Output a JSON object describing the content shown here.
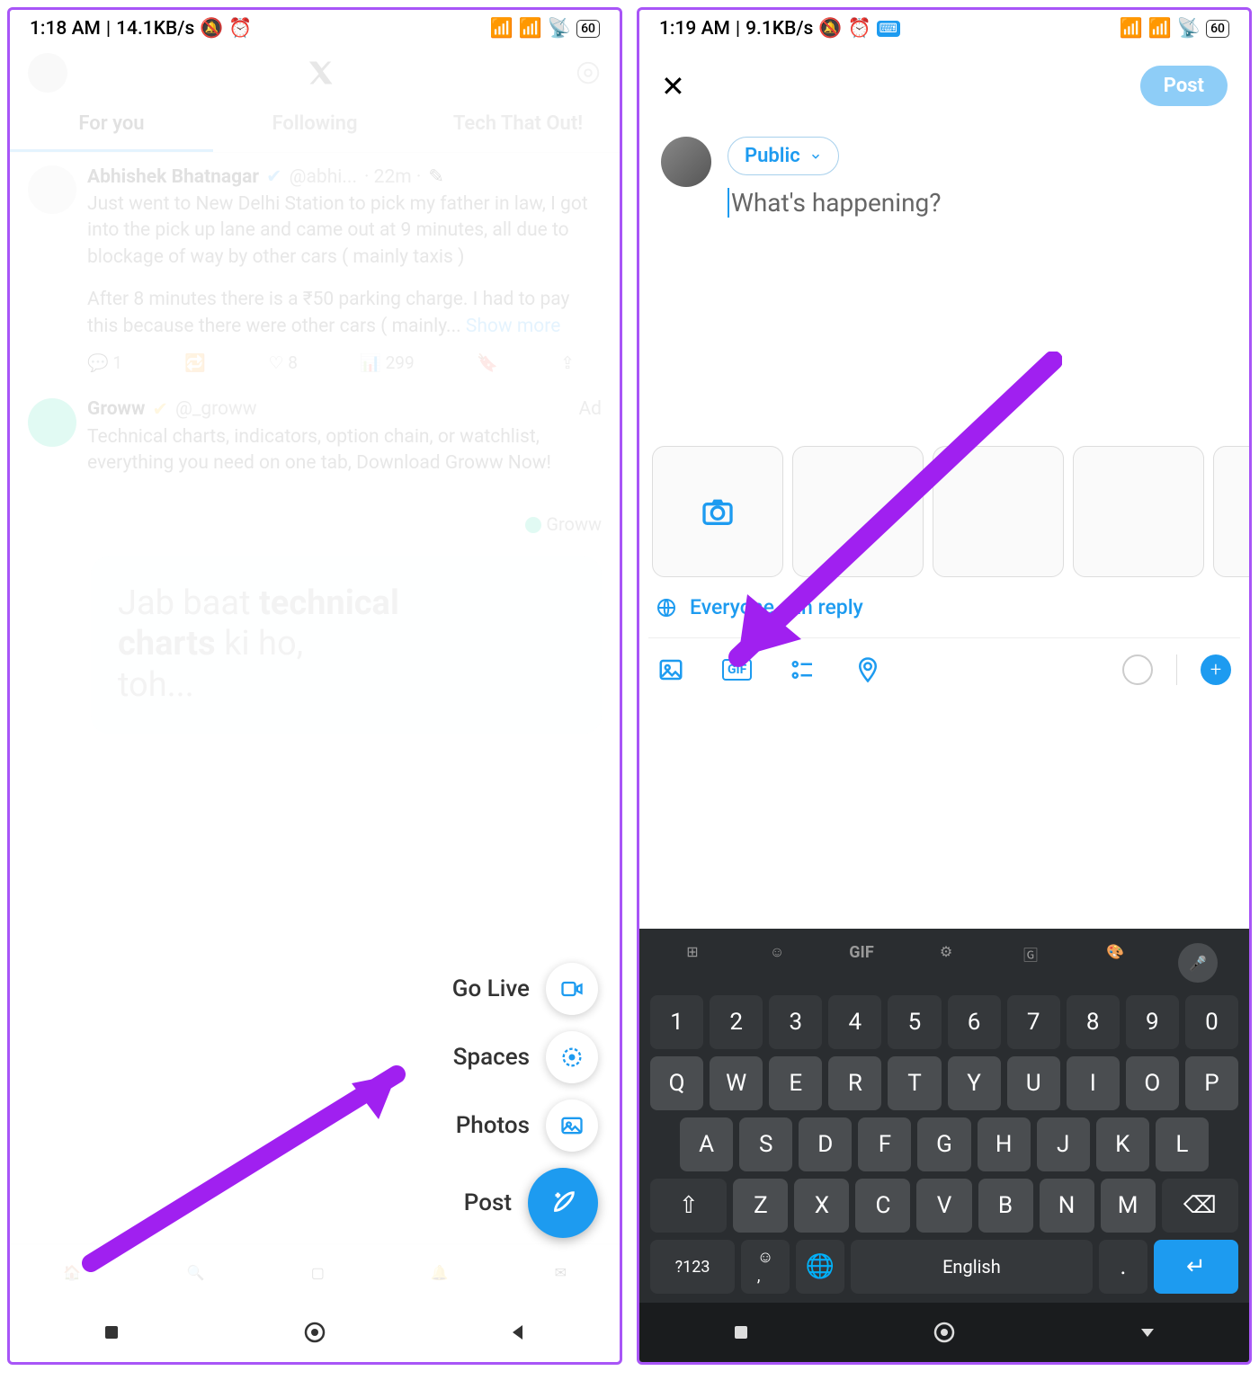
{
  "left": {
    "status": {
      "time": "1:18 AM",
      "speed": "14.1KB/s",
      "battery": "60"
    },
    "tabs": [
      "For you",
      "Following",
      "Tech That Out!"
    ],
    "tweet1": {
      "name": "Abhishek Bhatnagar",
      "handle": "@abhi...",
      "time": "· 22m ·",
      "body": "Just went to New Delhi Station to pick my father in law, I got into the pick up lane and came out at 9 minutes, all due to blockage of way by other cars ( mainly taxis )",
      "body2": "After 8 minutes there is a ₹50 parking charge. I had to pay this because there were other cars ( mainly...",
      "more": "Show more",
      "a1": "1",
      "a3": "8",
      "a4": "299"
    },
    "tweet2": {
      "name": "Groww",
      "handle": "@_groww",
      "tag": "Ad",
      "body": "Technical charts, indicators, option chain, or watchlist, everything you need on one tab, Download Groww Now!",
      "brand": "Groww"
    },
    "ad": {
      "l1": "Jab baat ",
      "l1b": "technical",
      "l2": "charts ",
      "l2b": "ki ho,",
      "l3": "toh..."
    },
    "fab": {
      "golive": "Go Live",
      "spaces": "Spaces",
      "photos": "Photos",
      "post": "Post"
    }
  },
  "right": {
    "status": {
      "time": "1:19 AM",
      "speed": "9.1KB/s",
      "battery": "60"
    },
    "post": "Post",
    "audience": "Public",
    "placeholder": "What's happening?",
    "reply": "Everyone can reply",
    "kb": {
      "nums": [
        "1",
        "2",
        "3",
        "4",
        "5",
        "6",
        "7",
        "8",
        "9",
        "0"
      ],
      "r1": [
        "Q",
        "W",
        "E",
        "R",
        "T",
        "Y",
        "U",
        "I",
        "O",
        "P"
      ],
      "r2": [
        "A",
        "S",
        "D",
        "F",
        "G",
        "H",
        "J",
        "K",
        "L"
      ],
      "r3": [
        "Z",
        "X",
        "C",
        "V",
        "B",
        "N",
        "M"
      ],
      "sym": "?123",
      "space": "English",
      "comma": ",",
      "period": "."
    }
  }
}
